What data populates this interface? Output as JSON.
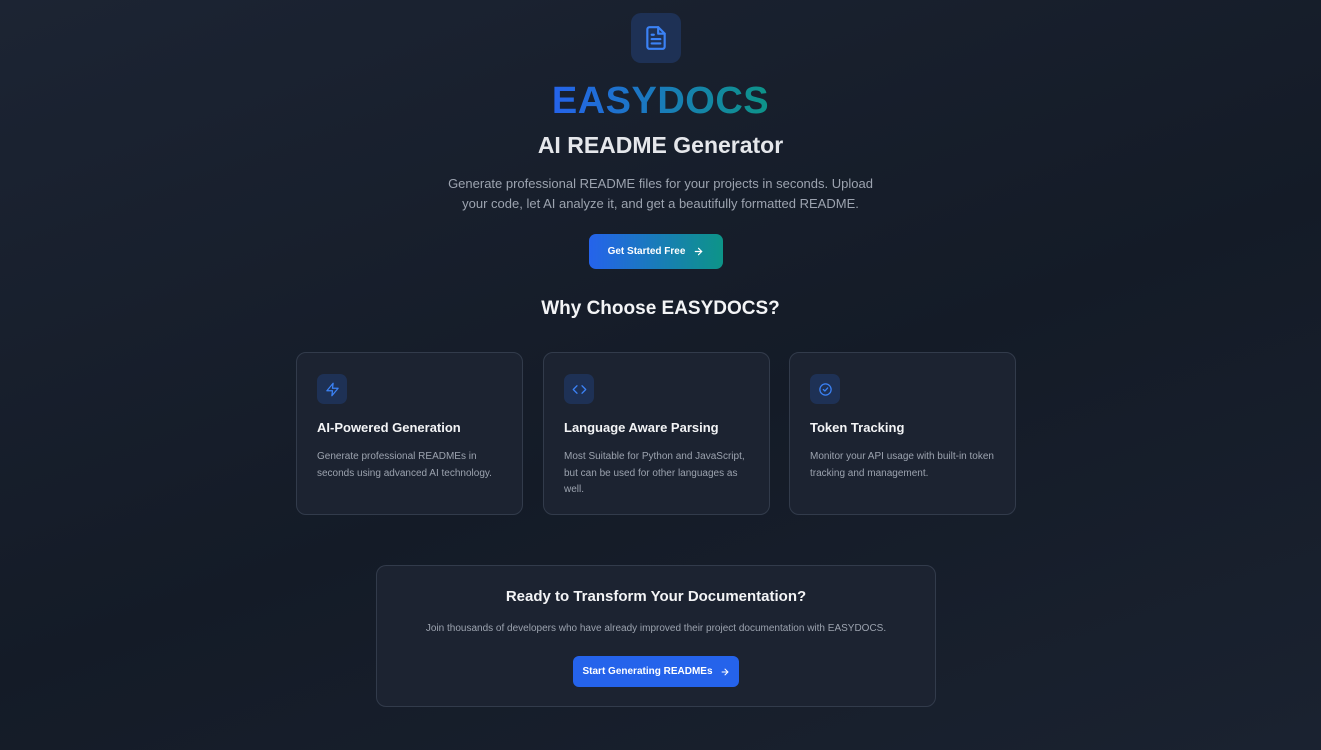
{
  "hero": {
    "logo_icon": "document-icon",
    "brand": "EASYDOCS",
    "subtitle": "AI README Generator",
    "description": "Generate professional README files for your projects in seconds. Upload your code, let AI analyze it, and get a beautifully formatted README.",
    "cta_label": "Get Started Free",
    "cta_icon": "arrow-right-icon"
  },
  "features": {
    "title": "Why Choose EASYDOCS?",
    "items": [
      {
        "icon": "lightning-icon",
        "title": "AI-Powered Generation",
        "text": "Generate professional READMEs in seconds using advanced AI technology."
      },
      {
        "icon": "code-icon",
        "title": "Language Aware Parsing",
        "text": "Most Suitable for Python and JavaScript, but can be used for other languages as well."
      },
      {
        "icon": "check-circle-icon",
        "title": "Token Tracking",
        "text": "Monitor your API usage with built-in token tracking and management."
      }
    ]
  },
  "bottom_cta": {
    "title": "Ready to Transform Your Documentation?",
    "text": "Join thousands of developers who have already improved their project documentation with EASYDOCS.",
    "button_label": "Start Generating READMEs",
    "button_icon": "arrow-right-icon"
  },
  "colors": {
    "accent_blue": "#2563eb",
    "accent_teal": "#0d9488",
    "icon_blue": "#3b82f6",
    "background": "#171e2b"
  }
}
